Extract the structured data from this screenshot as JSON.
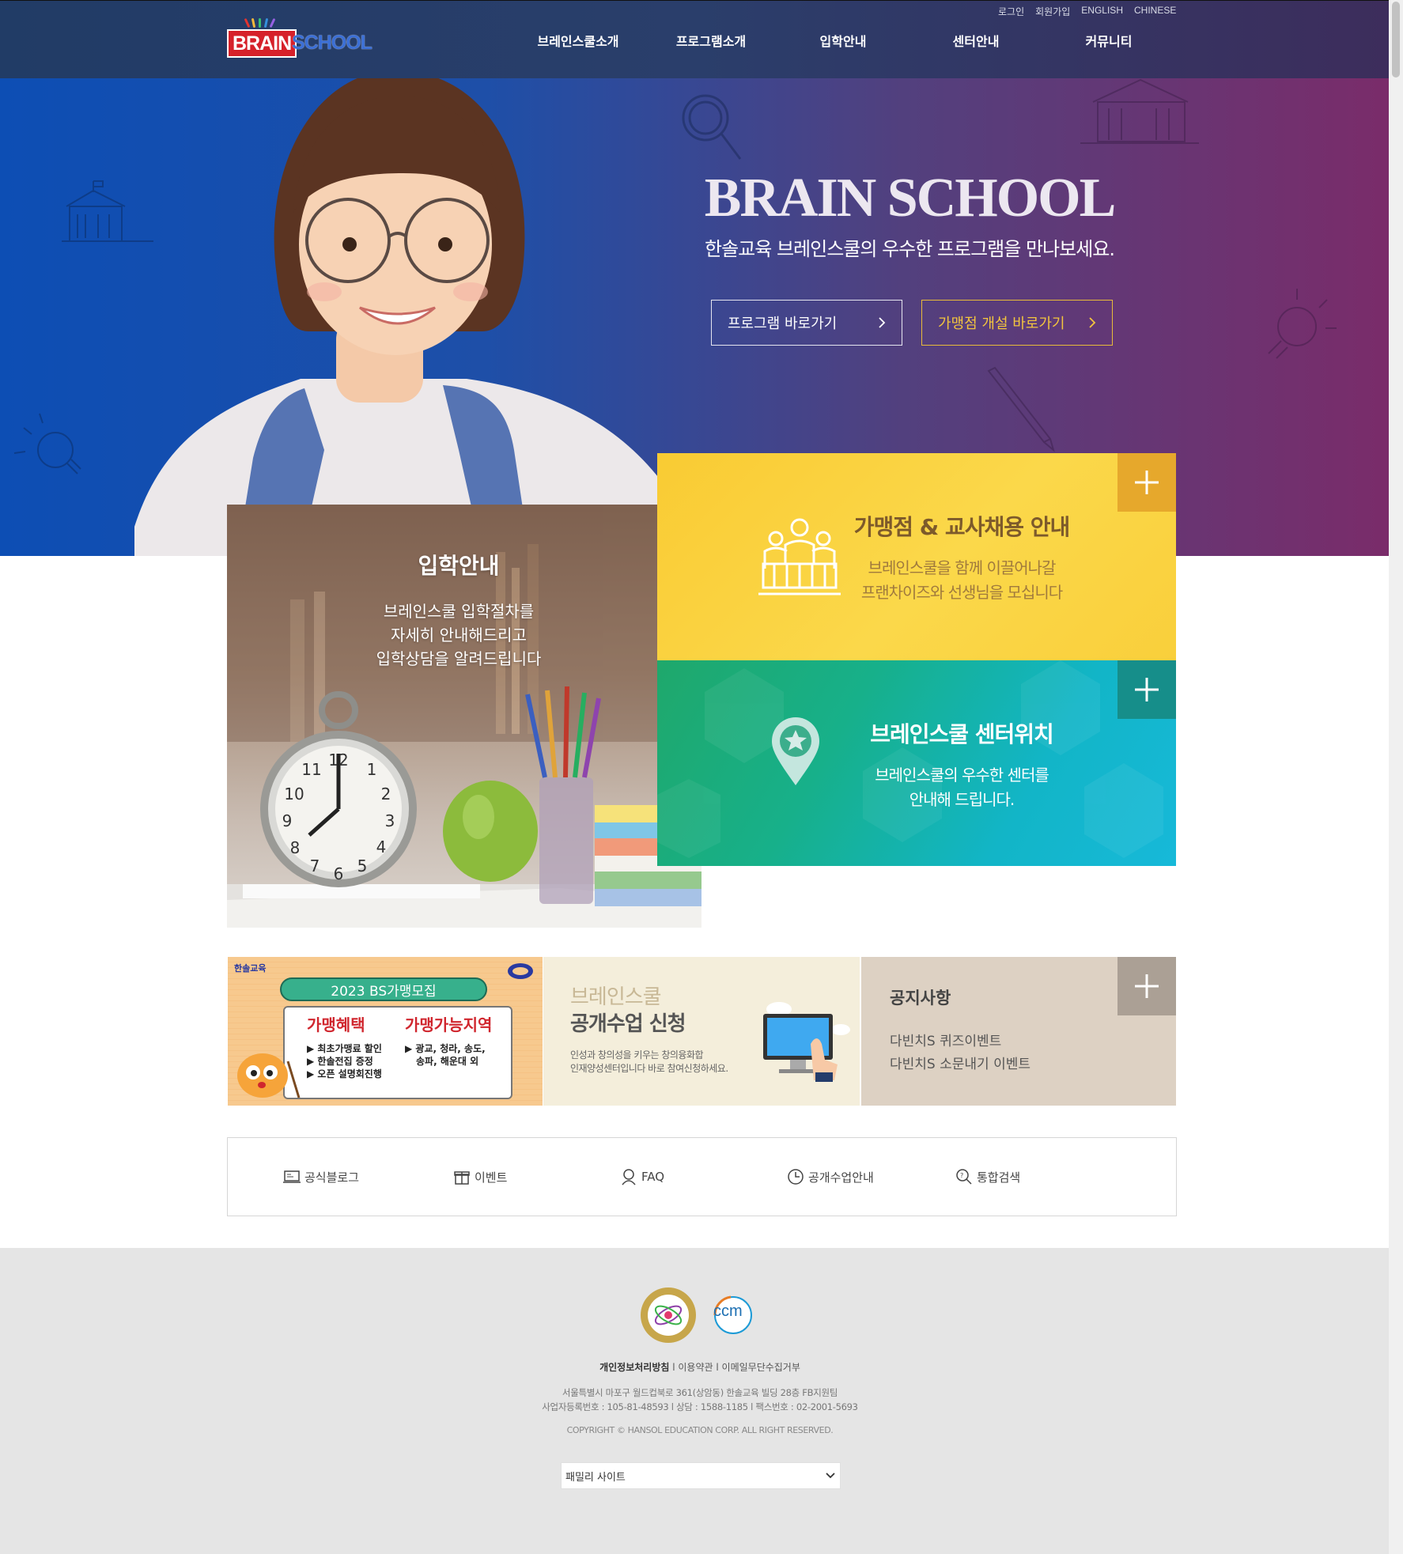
{
  "header": {
    "util_links": [
      "로그인",
      "회원가입",
      "ENGLISH",
      "CHINESE"
    ],
    "logo": {
      "brain": "BRAIN",
      "school": "SCHOOL"
    },
    "nav": [
      "브레인스쿨소개",
      "프로그램소개",
      "입학안내",
      "센터안내",
      "커뮤니티"
    ]
  },
  "hero": {
    "title": "BRAIN SCHOOL",
    "subtitle": "한솔교육 브레인스쿨의 우수한 프로그램을 만나보세요.",
    "btn_program": "프로그램 바로가기",
    "btn_franchise": "가맹점 개설 바로가기"
  },
  "cards": {
    "admission": {
      "title": "입학안내",
      "lines": [
        "브레인스쿨 입학절차를",
        "자세히 안내해드리고",
        "입학상담을 알려드립니다"
      ]
    },
    "franchise": {
      "title": "가맹점 & 교사채용 안내",
      "lines": [
        "브레인스쿨을 함께 이끌어나갈",
        "프랜차이즈와 선생님을 모십니다"
      ]
    },
    "center": {
      "title": "브레인스쿨 센터위치",
      "lines": [
        "브레인스쿨의 우수한 센터를",
        "안내해 드립니다."
      ]
    }
  },
  "banners": {
    "promo": {
      "brand": "한솔교육",
      "pill": "2023 BS가맹모집",
      "left_head": "가맹혜택",
      "left_items": [
        "▶ 최초가맹료 할인",
        "▶ 한솔전집 증정",
        "▶ 오픈 설명회진행"
      ],
      "right_head": "가맹가능지역",
      "right_items": [
        "▶ 광교, 청라, 송도,",
        "송파, 해운대 외"
      ]
    },
    "open_class": {
      "line1": "브레인스쿨",
      "line2": "공개수업 신청",
      "desc1": "인성과 창의성을 키우는 창의융화합",
      "desc2": "인재양성센터입니다 바로 참여신청하세요."
    },
    "notice": {
      "title": "공지사항",
      "items": [
        "다빈치S 퀴즈이벤트",
        "다빈치S 소문내기 이벤트"
      ]
    }
  },
  "quick_links": [
    {
      "label": "공식블로그",
      "icon": "blog-icon"
    },
    {
      "label": "이벤트",
      "icon": "gift-icon"
    },
    {
      "label": "FAQ",
      "icon": "faq-icon"
    },
    {
      "label": "공개수업안내",
      "icon": "clock-icon"
    },
    {
      "label": "통합검색",
      "icon": "search-icon"
    }
  ],
  "footer": {
    "badge_ccm": "ccm",
    "policy": "개인정보처리방침",
    "terms": "이용약관",
    "email": "이메일무단수집거부",
    "address": "서울특별시 마포구 월드컵북로 361(상암동) 한솔교육 빌딩 28층 FB지원팀",
    "biz": "사업자등록번호 : 105-81-48593 l 상담 : 1588-1185 l 팩스번호 : 02-2001-5693",
    "copyright": "COPYRIGHT © HANSOL EDUCATION CORP. ALL RIGHT RESERVED.",
    "family_site": "패밀리 사이트"
  },
  "colors": {
    "header_bg": "#2a3e6b",
    "hero_left": "#0d4eb4",
    "hero_right": "#7a2c6a",
    "yellow_card": "#fbd84a",
    "green_card": "#12b5c7",
    "notice_bg": "#ddd1c3"
  }
}
